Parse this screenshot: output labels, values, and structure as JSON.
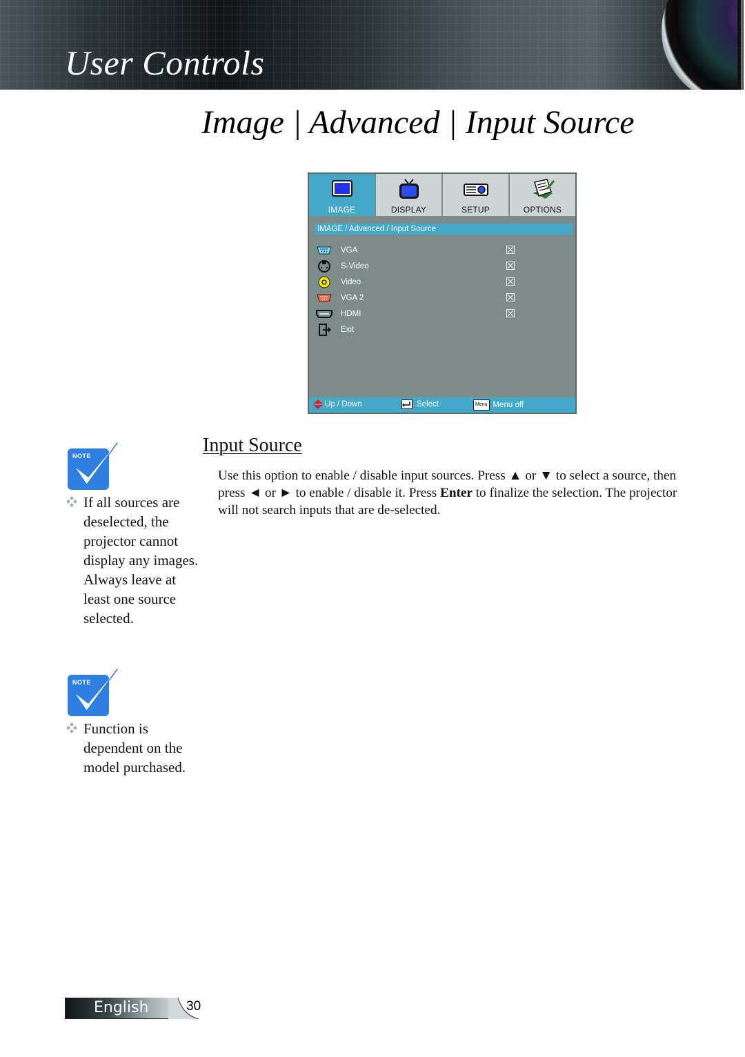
{
  "header": {
    "banner_title": "User Controls",
    "page_heading": "Image | Advanced | Input Source"
  },
  "osd": {
    "tabs": [
      {
        "label": "IMAGE",
        "icon": "monitor-icon",
        "active": true
      },
      {
        "label": "DISPLAY",
        "icon": "tv-icon",
        "active": false
      },
      {
        "label": "SETUP",
        "icon": "projector-icon",
        "active": false
      },
      {
        "label": "OPTIONS",
        "icon": "notepad-icon",
        "active": false
      }
    ],
    "breadcrumb": "IMAGE / Advanced / Input Source",
    "items": [
      {
        "label": "VGA",
        "icon": "vga-port-icon",
        "checked": true
      },
      {
        "label": "S-Video",
        "icon": "svideo-port-icon",
        "checked": true
      },
      {
        "label": "Video",
        "icon": "rca-port-icon",
        "checked": true
      },
      {
        "label": "VGA 2",
        "icon": "vga2-port-icon",
        "checked": true
      },
      {
        "label": "HDMI",
        "icon": "hdmi-port-icon",
        "checked": true
      },
      {
        "label": "Exit",
        "icon": "exit-icon",
        "checked": null
      }
    ],
    "statusbar": {
      "updown": "Up / Down",
      "select": "Select",
      "menu_key": "Menu",
      "menuoff": "Menu off"
    },
    "colors": {
      "accent": "#44a9c9",
      "panel": "#7b8c8b",
      "tab_inactive": "#cfd5d6"
    }
  },
  "section": {
    "title": "Input Source",
    "body_part1": "Use this option to enable / disable input sources. Press ▲ or ▼ to select a source, then press ◄ or ► to enable / disable it. Press ",
    "body_bold": "Enter",
    "body_part2": " to finalize the selection. The projector will not search inputs that are de-selected."
  },
  "notes": [
    {
      "badge": "NOTE",
      "text": "If all sources are deselected, the projector cannot display any images. Always leave at least one source selected."
    },
    {
      "badge": "NOTE",
      "text": "Function is dependent on the model purchased."
    }
  ],
  "footer": {
    "language": "English",
    "page_number": "30"
  }
}
